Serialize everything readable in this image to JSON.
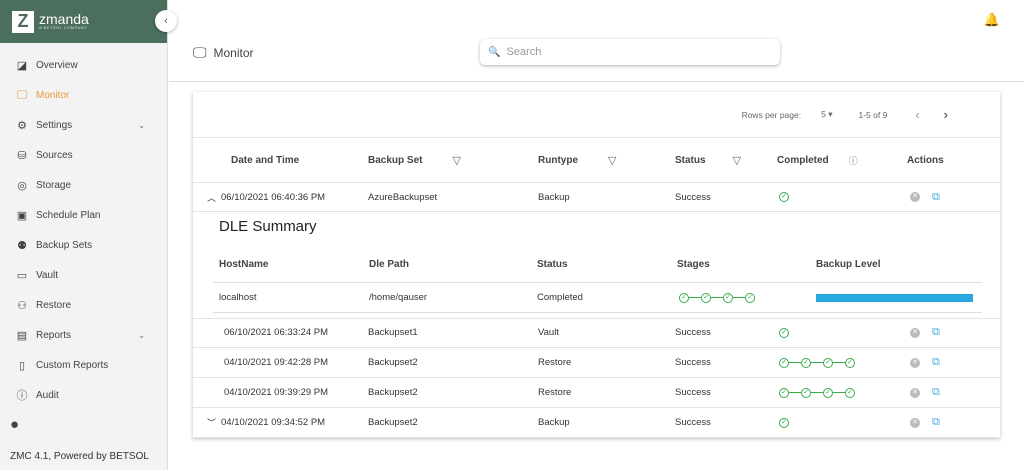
{
  "brand": {
    "logo_letter": "Z",
    "name": "zmanda",
    "tagline": "A BETSOL COMPANY"
  },
  "sidebar": {
    "items": [
      {
        "label": "Overview",
        "icon": "overview-icon",
        "glyph": "◪"
      },
      {
        "label": "Monitor",
        "icon": "monitor-icon",
        "glyph": "🖵"
      },
      {
        "label": "Settings",
        "icon": "gear-icon",
        "glyph": "⚙"
      },
      {
        "label": "Sources",
        "icon": "sources-icon",
        "glyph": "⛁"
      },
      {
        "label": "Storage",
        "icon": "storage-icon",
        "glyph": "◎"
      },
      {
        "label": "Schedule Plan",
        "icon": "calendar-icon",
        "glyph": "▣"
      },
      {
        "label": "Backup Sets",
        "icon": "backup-sets-icon",
        "glyph": "⚉"
      },
      {
        "label": "Vault",
        "icon": "vault-icon",
        "glyph": "▭"
      },
      {
        "label": "Restore",
        "icon": "restore-icon",
        "glyph": "⚇"
      },
      {
        "label": "Reports",
        "icon": "reports-icon",
        "glyph": "▤"
      },
      {
        "label": "Custom Reports",
        "icon": "custom-reports-icon",
        "glyph": "▯"
      },
      {
        "label": "Audit",
        "icon": "audit-icon",
        "glyph": "ⓘ"
      }
    ],
    "footer": "ZMC 4.1, Powered by BETSOL"
  },
  "header": {
    "title": "Monitor",
    "search_placeholder": "Search"
  },
  "pagination": {
    "rows_label": "Rows per page:",
    "rows_value": "5",
    "range": "1-5 of 9"
  },
  "table": {
    "columns": [
      "Date and Time",
      "Backup Set",
      "Runtype",
      "Status",
      "Completed",
      "Actions"
    ],
    "rows": [
      {
        "date": "06/10/2021 06:40:36 PM",
        "set": "AzureBackupset",
        "runtype": "Backup",
        "status": "Success"
      },
      {
        "date": "06/10/2021 06:33:24 PM",
        "set": "Backupset1",
        "runtype": "Vault",
        "status": "Success"
      },
      {
        "date": "04/10/2021 09:42:28 PM",
        "set": "Backupset2",
        "runtype": "Restore",
        "status": "Success"
      },
      {
        "date": "04/10/2021 09:39:29 PM",
        "set": "Backupset2",
        "runtype": "Restore",
        "status": "Success"
      },
      {
        "date": "04/10/2021 09:34:52 PM",
        "set": "Backupset2",
        "runtype": "Backup",
        "status": "Success"
      }
    ]
  },
  "dle": {
    "title": "DLE Summary",
    "columns": [
      "HostName",
      "Dle Path",
      "Status",
      "Stages",
      "Backup Level"
    ],
    "row": {
      "host": "localhost",
      "path": "/home/qauser",
      "status": "Completed",
      "backup_level_percent": 100
    }
  }
}
